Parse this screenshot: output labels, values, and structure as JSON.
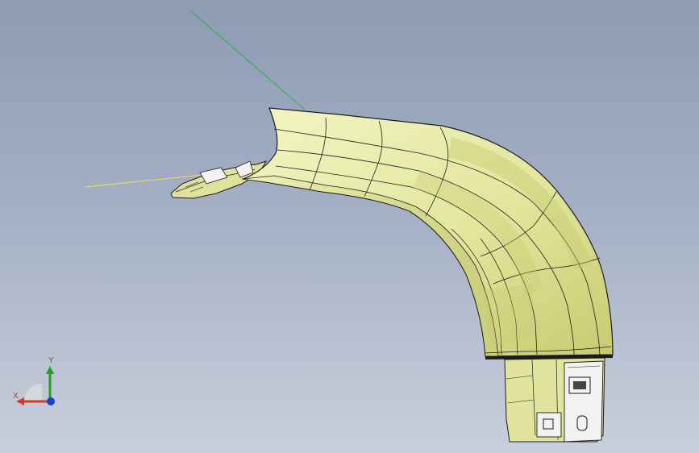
{
  "viewport": {
    "background_top": "#8e9bb3",
    "background_bottom": "#c8cfdc"
  },
  "model": {
    "surface_color": "#e3e69c",
    "shade_color": "#c6cb70",
    "edge_color": "#1c1c1c",
    "bracket_color": "#f2f2f2"
  },
  "reference_lines": {
    "green_line_color": "#22b34a",
    "yellow_line_color": "#e7e25a"
  },
  "triad": {
    "y_label": "Y",
    "x_label": "X",
    "y_color": "#22a022",
    "x_color": "#d23a2a",
    "z_color": "#1f3fd0"
  }
}
